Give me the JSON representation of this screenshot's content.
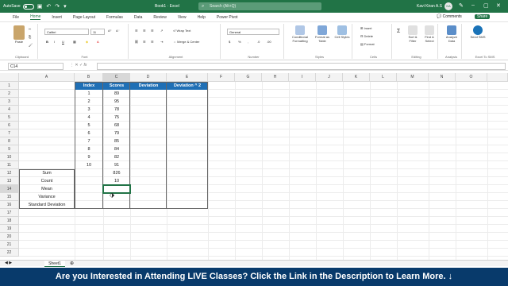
{
  "titlebar": {
    "autosave_label": "AutoSave",
    "toggle_state": "Off",
    "doc_name": "Book1 · Excel",
    "search_placeholder": "Search (Alt+Q)",
    "user_name": "Kavi Kiran A.S",
    "avatar_initials": "KA",
    "accent_color": "#217346"
  },
  "menu": {
    "items": [
      "File",
      "Home",
      "Insert",
      "Page Layout",
      "Formulas",
      "Data",
      "Review",
      "View",
      "Help",
      "Power Pivot"
    ],
    "active": "Home",
    "comments": "Comments",
    "share": "Share"
  },
  "ribbon": {
    "clipboard": {
      "label": "Clipboard",
      "paste": "Paste"
    },
    "font": {
      "label": "Font",
      "font_name": "Calibri",
      "font_size": "11",
      "bold": "B",
      "italic": "I",
      "underline": "U"
    },
    "alignment": {
      "label": "Alignment",
      "wrap": "Wrap Text",
      "merge": "Merge & Center"
    },
    "number": {
      "label": "Number",
      "format": "General",
      "currency": "$",
      "percent": "%",
      "comma": ","
    },
    "styles": {
      "label": "Styles",
      "conditional": "Conditional Formatting",
      "table": "Format as Table",
      "cell": "Cell Styles"
    },
    "cells": {
      "label": "Cells",
      "insert": "Insert",
      "delete": "Delete",
      "format": "Format"
    },
    "editing": {
      "label": "Editing",
      "sort": "Sort & Filter",
      "find": "Find & Select"
    },
    "analysis": {
      "label": "Analysis",
      "analyze": "Analyze Data"
    },
    "excel2pdf": {
      "label": "Excel To SMS",
      "send": "Send SMS"
    }
  },
  "formula_bar": {
    "name_box": "C14",
    "fx": "fx",
    "content": ""
  },
  "grid": {
    "columns": [
      "A",
      "B",
      "C",
      "D",
      "E",
      "F",
      "G",
      "H",
      "I",
      "J",
      "K",
      "L",
      "M",
      "N",
      "O"
    ],
    "rows": [
      "1",
      "2",
      "3",
      "4",
      "5",
      "6",
      "7",
      "8",
      "9",
      "10",
      "11",
      "12",
      "13",
      "14",
      "15",
      "16",
      "17",
      "18",
      "19",
      "20",
      "21",
      "22"
    ],
    "headers": [
      "Index",
      "Scores",
      "Deviation",
      "Deviation ^ 2"
    ],
    "index": [
      "1",
      "2",
      "3",
      "4",
      "5",
      "6",
      "7",
      "8",
      "9",
      "10"
    ],
    "scores": [
      "89",
      "95",
      "78",
      "75",
      "68",
      "79",
      "85",
      "84",
      "82",
      "91"
    ],
    "labels": [
      "Sum",
      "Count",
      "Mean",
      "Variance",
      "Standard Deviation"
    ],
    "sum_value": "826",
    "count_value": "10",
    "header_color": "#1f6fb5"
  },
  "sheets": {
    "tabs": [
      "Sheet1"
    ]
  },
  "banner": {
    "text": "Are you Interested in Attending LIVE Classes? Click the Link in the Description to Learn More. ↓",
    "color": "#083a6b"
  }
}
